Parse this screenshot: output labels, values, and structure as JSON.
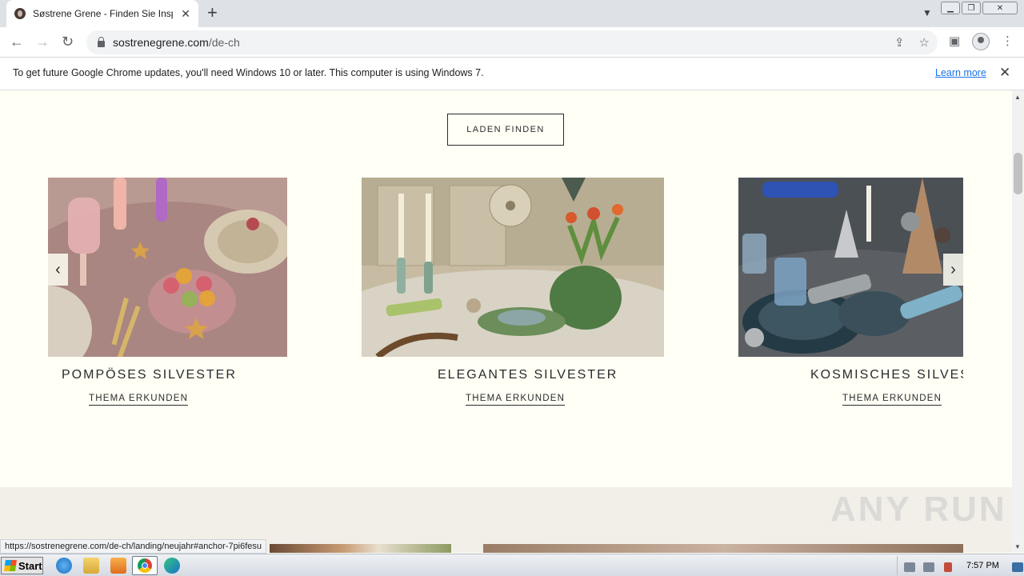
{
  "browser": {
    "tab_title": "Søstrene Grene - Finden Sie Inspirat",
    "url_host": "sostrenegrene.com",
    "url_path": "/de-ch",
    "infobar_text": "To get future Google Chrome updates, you'll need Windows 10 or later. This computer is using Windows 7.",
    "infobar_link": "Learn more",
    "status_url": "https://sostrenegrene.com/de-ch/landing/neujahr#anchor-7pi6fesu"
  },
  "page": {
    "store_button": "LADEN FINDEN",
    "cards": [
      {
        "title": "POMPÖSES SILVESTER",
        "link": "THEMA ERKUNDEN"
      },
      {
        "title": "ELEGANTES SILVESTER",
        "link": "THEMA ERKUNDEN"
      },
      {
        "title": "KOSMISCHES SILVESTER",
        "link": "THEMA ERKUNDEN"
      }
    ]
  },
  "taskbar": {
    "start_label": "Start",
    "clock": "7:57 PM"
  },
  "watermark": "ANY RUN"
}
